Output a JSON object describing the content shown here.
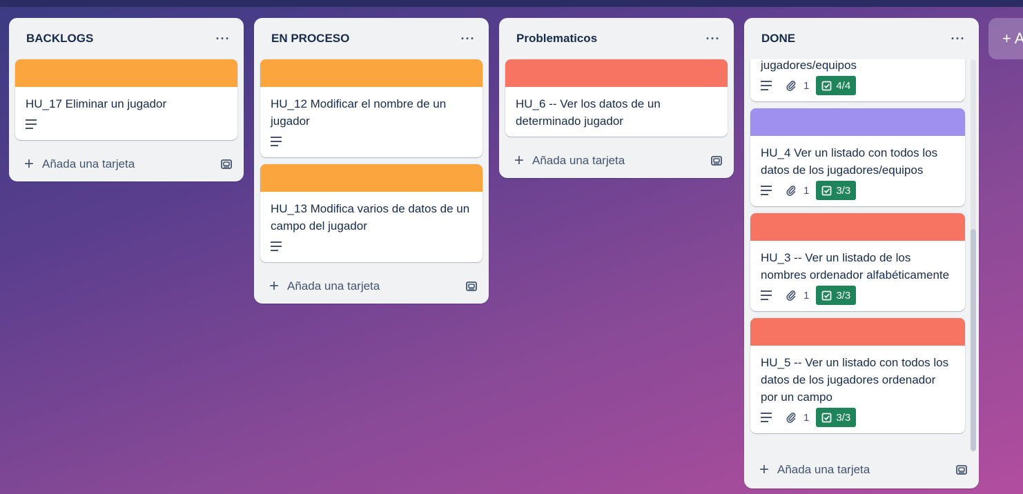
{
  "colors": {
    "orange": "#faa53d",
    "red": "#f87462",
    "purple": "#9f8fef",
    "check_green": "#1f845a"
  },
  "icons": {
    "menu": "ellipsis-icon",
    "add": "plus-icon",
    "template": "card-template-icon",
    "description": "description-icon",
    "attachment": "paperclip-icon",
    "checklist": "checkbox-icon"
  },
  "add_list": {
    "label": "+ A"
  },
  "lists": [
    {
      "title": "BACKLOGS",
      "menu_label": "···",
      "add_card_label": "Añada una tarjeta",
      "cards": [
        {
          "title": "HU_17 Eliminar un jugador",
          "cover": "orange"
        }
      ]
    },
    {
      "title": "EN PROCESO",
      "menu_label": "···",
      "add_card_label": "Añada una tarjeta",
      "cards": [
        {
          "title": "HU_12 Modificar el nombre de un jugador",
          "cover": "orange"
        },
        {
          "title": "HU_13 Modifica varios de datos de un campo del jugador",
          "cover": "orange"
        }
      ]
    },
    {
      "title": "Problematicos",
      "menu_label": "···",
      "add_card_label": "Añada una tarjeta",
      "cards": [
        {
          "title": "HU_6 -- Ver los datos de un determinado jugador",
          "cover": "red"
        }
      ]
    },
    {
      "title": "DONE",
      "menu_label": "···",
      "add_card_label": "Añada una tarjeta",
      "cards": [
        {
          "title": "jugadores/equipos",
          "attachments": "1",
          "checklist": "4/4"
        },
        {
          "title": "HU_4 Ver un listado con todos los datos de los jugadores/equipos",
          "cover": "purple",
          "attachments": "1",
          "checklist": "3/3"
        },
        {
          "title": "HU_3 -- Ver un listado de los nombres ordenador alfabéticamente",
          "cover": "red",
          "attachments": "1",
          "checklist": "3/3"
        },
        {
          "title": "HU_5 -- Ver un listado con todos los datos de los jugadores ordenador por un campo",
          "cover": "red",
          "attachments": "1",
          "checklist": "3/3"
        }
      ]
    }
  ]
}
